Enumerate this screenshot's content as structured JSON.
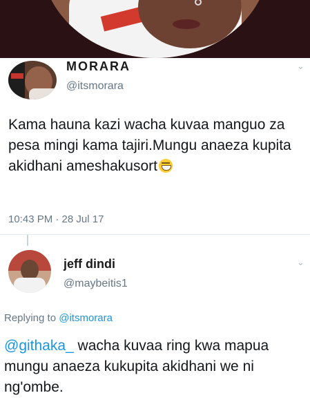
{
  "original_tweet": {
    "display_name": "MORARA",
    "handle": "@itsmorara",
    "text": "Kama hauna kazi wacha kuvaa manguo za pesa mingi kama tajiri.Mungu anaeza kupita akidhani ameshakusort",
    "emoji": "grinning-face-emoji",
    "timestamp": "10:43 PM · 28 Jul 17"
  },
  "reply_tweet": {
    "display_name": "jeff dindi",
    "handle": "@maybeitis1",
    "replying_to_label": "Replying to",
    "replying_to_handle": "@itsmorara",
    "mention": "@githaka_",
    "text": " wacha kuvaa ring kwa mapua mungu anaeza kukupita akidhani we ni ng'ombe."
  },
  "icons": {
    "menu": "chevron-down-icon"
  },
  "colors": {
    "link": "#1b95e0",
    "secondary_text": "#657786",
    "divider": "#e1e8ed"
  }
}
